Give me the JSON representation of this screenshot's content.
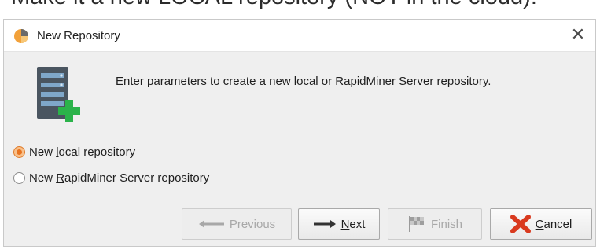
{
  "caption": "Make it a new LOCAL repository (NOT in the cloud).",
  "dialog": {
    "title": "New Repository",
    "close_glyph": "✕",
    "instruction": "Enter parameters to create a new local or RapidMiner Server repository.",
    "options": [
      {
        "pre": "New ",
        "mnemonic": "l",
        "post": "ocal repository",
        "selected": true
      },
      {
        "pre": "New ",
        "mnemonic": "R",
        "post": "apidMiner Server repository",
        "selected": false
      }
    ],
    "buttons": {
      "previous": {
        "label": "Previous",
        "enabled": false,
        "icon": "arrow-left-icon"
      },
      "next": {
        "mnemonic": "N",
        "rest": "ext",
        "enabled": true,
        "icon": "arrow-right-icon"
      },
      "finish": {
        "label": "Finish",
        "enabled": false,
        "icon": "flag-icon"
      },
      "cancel": {
        "mnemonic": "C",
        "rest": "ancel",
        "enabled": true,
        "icon": "red-x-icon"
      }
    }
  },
  "colors": {
    "radio_selected": "#e8731f",
    "add_badge": "#2bb34a",
    "cancel_x": "#d93a1f"
  }
}
